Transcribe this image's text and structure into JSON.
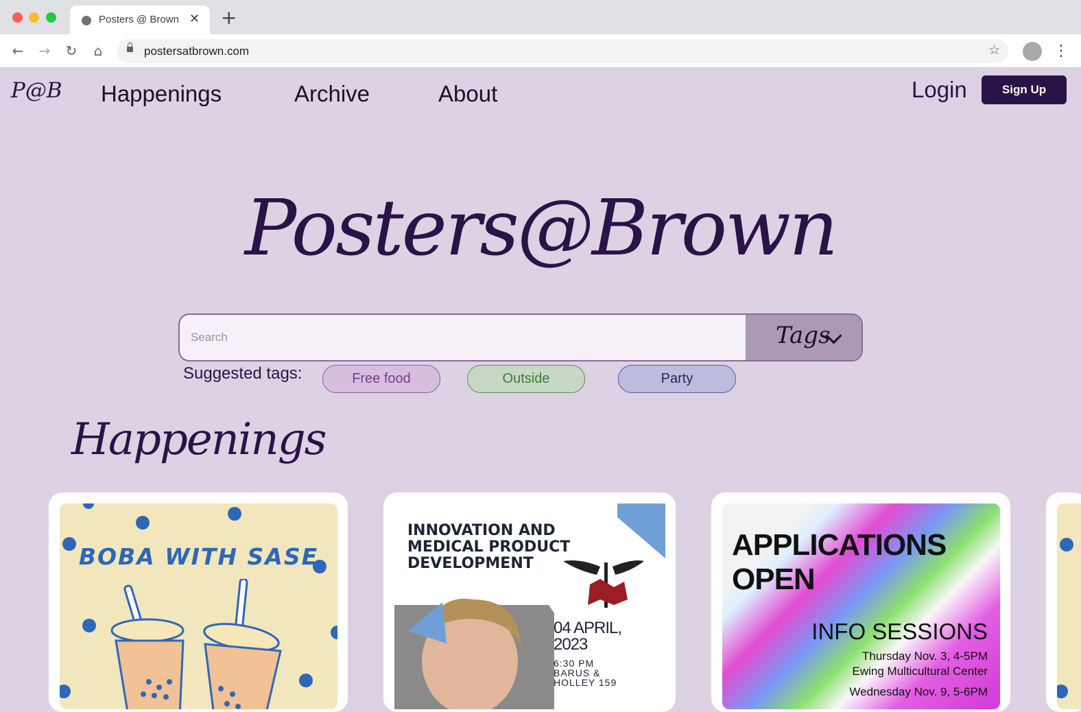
{
  "browser": {
    "tab_title": "Posters @ Brown",
    "url": "postersatbrown.com",
    "new_tab_symbol": "+"
  },
  "nav": {
    "logo": "P@B",
    "links": [
      "Happenings",
      "Archive",
      "About"
    ],
    "login": "Login",
    "signup": "Sign Up"
  },
  "hero": {
    "title": "Posters@Brown"
  },
  "search": {
    "placeholder": "Search",
    "tags_label": "Tags"
  },
  "suggested": {
    "label": "Suggested tags:",
    "tags": [
      "Free food",
      "Outside",
      "Party"
    ]
  },
  "section": {
    "title": "Happenings"
  },
  "posters": {
    "boba": {
      "title": "BOBA WITH SASE"
    },
    "medical": {
      "title_line1": "INNOVATION AND",
      "title_line2": "MEDICAL PRODUCT",
      "title_line3": "DEVELOPMENT",
      "date_line1": "04 APRIL,",
      "date_line2": "2023",
      "details_line1": "6:30 PM",
      "details_line2": "BARUS &",
      "details_line3": "HOLLEY 159"
    },
    "applications": {
      "title_line1": "APPLICATIONS",
      "title_line2": "OPEN",
      "subtitle": "INFO SESSIONS",
      "line1": "Thursday Nov. 3, 4-5PM",
      "line2": "Ewing Multicultural Center",
      "line3": "Wednesday Nov. 9, 5-6PM"
    }
  },
  "colors": {
    "background": "#ddd2e3",
    "brand": "#2a1347",
    "tag_free_food": "#d7bedf",
    "tag_outside": "#c7d8c4",
    "tag_party": "#bcbcde"
  }
}
